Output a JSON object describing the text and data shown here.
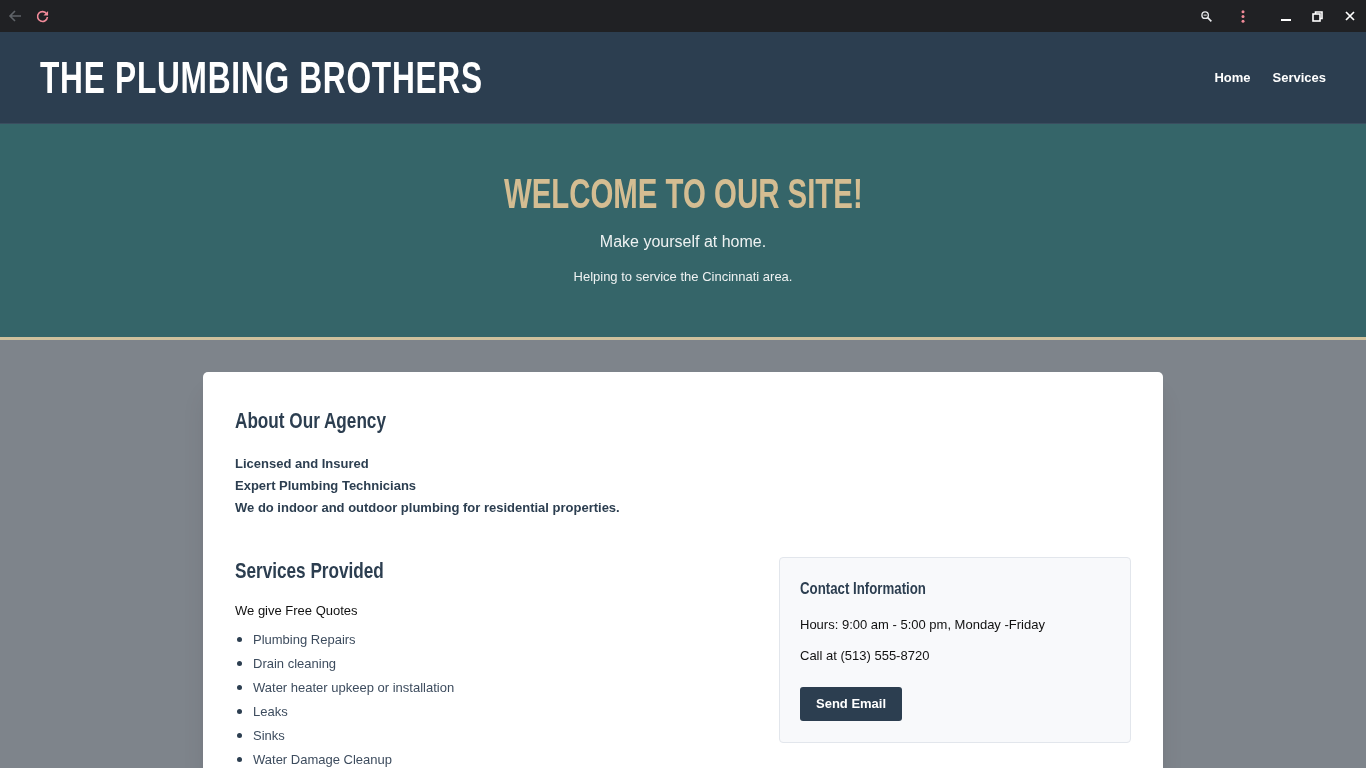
{
  "header": {
    "logo": "THE PLUMBING BROTHERS",
    "nav": [
      {
        "label": "Home"
      },
      {
        "label": "Services"
      }
    ]
  },
  "hero": {
    "title": "WELCOME TO OUR SITE!",
    "subtitle": "Make yourself at home.",
    "tagline": "Helping to service the Cincinnati area."
  },
  "about": {
    "heading": "About Our Agency",
    "lines": [
      "Licensed and Insured",
      "Expert Plumbing Technicians",
      "We do indoor and outdoor plumbing for residential properties."
    ]
  },
  "services": {
    "heading": "Services Provided",
    "intro": "We give Free Quotes",
    "items": [
      "Plumbing Repairs",
      "Drain cleaning",
      "Water heater upkeep or installation",
      "Leaks",
      "Sinks",
      "Water Damage Cleanup"
    ]
  },
  "contact": {
    "heading": "Contact Information",
    "lines": [
      "Hours: 9:00 am - 5:00 pm, Monday -Friday",
      "Call at (513) 555-8720"
    ],
    "button": "Send Email"
  }
}
